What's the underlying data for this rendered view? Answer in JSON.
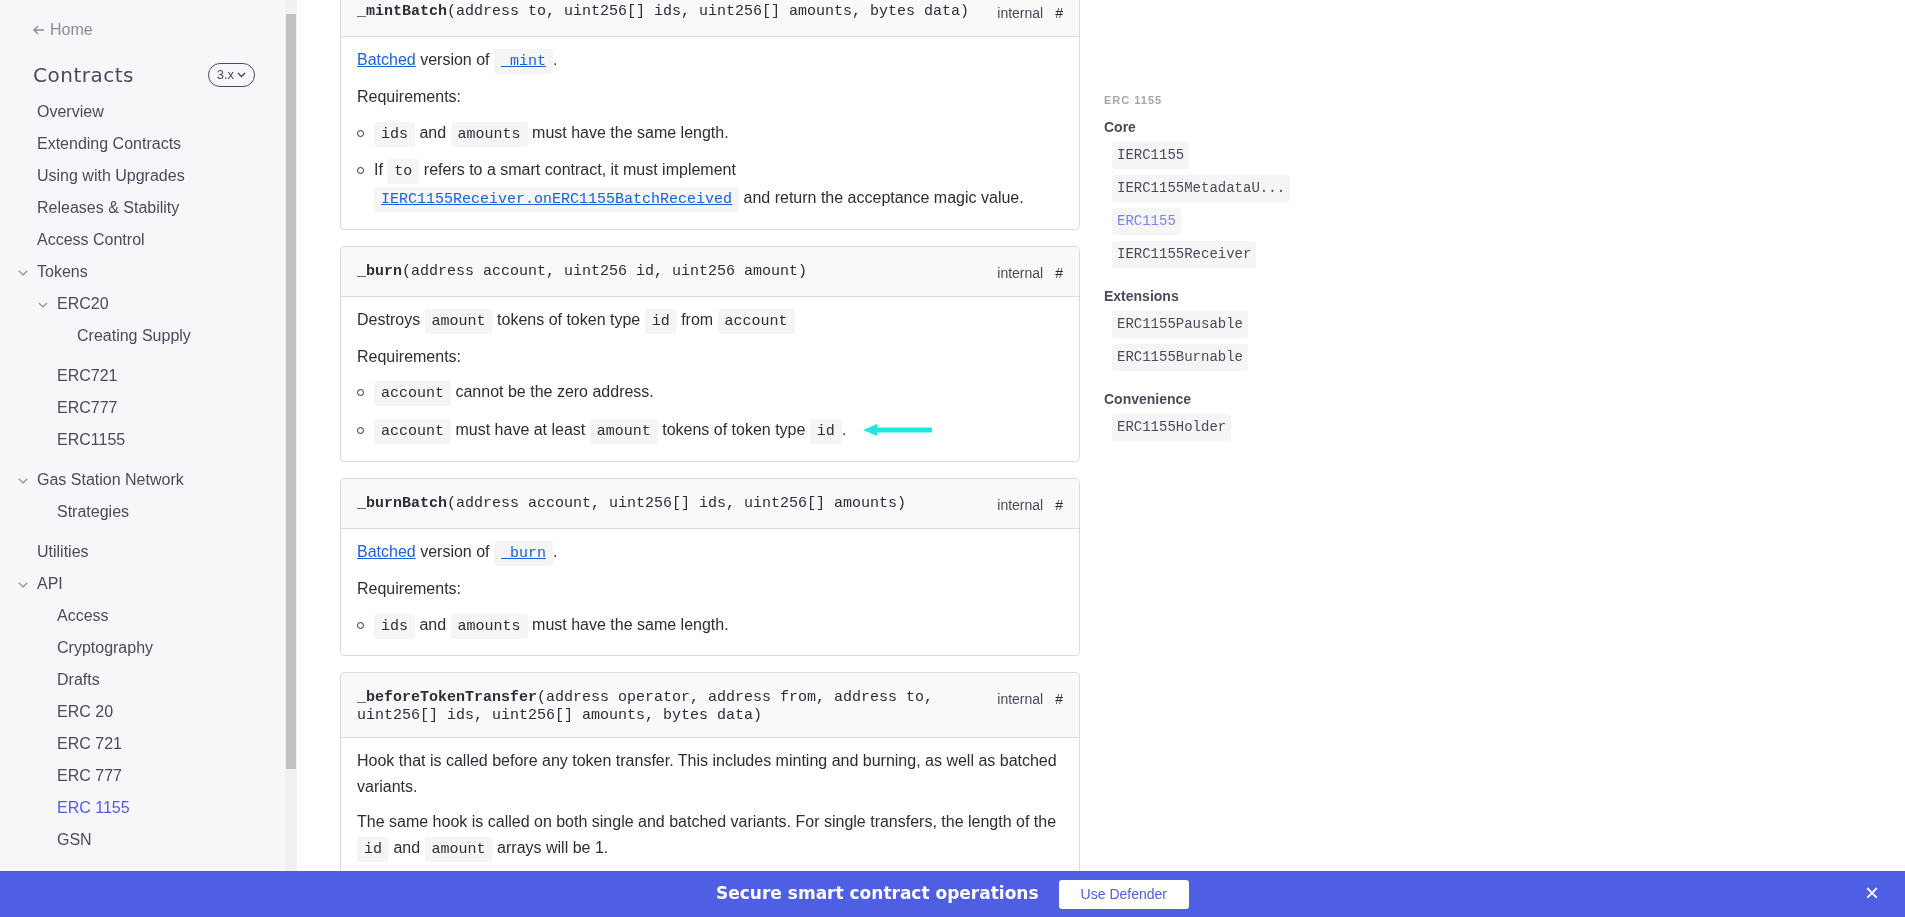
{
  "sidebar": {
    "home_link": "Home",
    "title": "Contracts",
    "version": "3.x",
    "items": [
      {
        "label": "Overview",
        "selected": false
      },
      {
        "label": "Extending Contracts",
        "selected": false
      },
      {
        "label": "Using with Upgrades",
        "selected": false
      },
      {
        "label": "Releases & Stability",
        "selected": false
      },
      {
        "label": "Access Control",
        "selected": false
      },
      {
        "label": "Tokens",
        "selected": false,
        "expanded": true,
        "children": [
          {
            "label": "ERC20",
            "selected": false,
            "expanded": true,
            "children": [
              {
                "label": "Creating Supply",
                "selected": false
              }
            ]
          },
          {
            "label": "ERC721",
            "selected": false
          },
          {
            "label": "ERC777",
            "selected": false
          },
          {
            "label": "ERC1155",
            "selected": false
          }
        ]
      },
      {
        "label": "Gas Station Network",
        "selected": false,
        "expanded": true,
        "children": [
          {
            "label": "Strategies",
            "selected": false
          }
        ]
      },
      {
        "label": "Utilities",
        "selected": false
      },
      {
        "label": "API",
        "selected": false,
        "expanded": true,
        "children": [
          {
            "label": "Access",
            "selected": false
          },
          {
            "label": "Cryptography",
            "selected": false
          },
          {
            "label": "Drafts",
            "selected": false
          },
          {
            "label": "ERC 20",
            "selected": false
          },
          {
            "label": "ERC 721",
            "selected": false
          },
          {
            "label": "ERC 777",
            "selected": false
          },
          {
            "label": "ERC 1155",
            "selected": true
          },
          {
            "label": "GSN",
            "selected": false
          }
        ]
      }
    ]
  },
  "functions": [
    {
      "name": "_mintBatch",
      "params": "(address to, uint256[] ids, uint256[] amounts, bytes data)",
      "visibility": "internal",
      "anchor": "#",
      "body": [
        {
          "kind": "paragraph",
          "segments": [
            {
              "kind": "link",
              "text": "Batched"
            },
            {
              "kind": "text",
              "text": " version of "
            },
            {
              "kind": "code-link",
              "text": "_mint"
            },
            {
              "kind": "text",
              "text": "."
            }
          ]
        },
        {
          "kind": "paragraph",
          "segments": [
            {
              "kind": "text",
              "text": "Requirements:"
            }
          ]
        },
        {
          "kind": "list",
          "items": [
            {
              "highlighted": false,
              "segments": [
                {
                  "kind": "code",
                  "text": "ids"
                },
                {
                  "kind": "text",
                  "text": " and "
                },
                {
                  "kind": "code",
                  "text": "amounts"
                },
                {
                  "kind": "text",
                  "text": " must have the same length."
                }
              ]
            },
            {
              "highlighted": false,
              "segments": [
                {
                  "kind": "text",
                  "text": "If "
                },
                {
                  "kind": "code",
                  "text": "to"
                },
                {
                  "kind": "text",
                  "text": " refers to a smart contract, it must implement "
                },
                {
                  "kind": "code-link",
                  "text": "IERC1155Receiver.onERC1155BatchReceived"
                },
                {
                  "kind": "text",
                  "text": " and return the acceptance magic value."
                }
              ]
            }
          ]
        }
      ]
    },
    {
      "name": "_burn",
      "params": "(address account, uint256 id, uint256 amount)",
      "visibility": "internal",
      "anchor": "#",
      "body": [
        {
          "kind": "paragraph",
          "segments": [
            {
              "kind": "text",
              "text": "Destroys "
            },
            {
              "kind": "code",
              "text": "amount"
            },
            {
              "kind": "text",
              "text": " tokens of token type "
            },
            {
              "kind": "code",
              "text": "id"
            },
            {
              "kind": "text",
              "text": " from "
            },
            {
              "kind": "code",
              "text": "account"
            }
          ]
        },
        {
          "kind": "paragraph",
          "segments": [
            {
              "kind": "text",
              "text": "Requirements:"
            }
          ]
        },
        {
          "kind": "list",
          "items": [
            {
              "highlighted": false,
              "segments": [
                {
                  "kind": "code",
                  "text": "account"
                },
                {
                  "kind": "text",
                  "text": " cannot be the zero address."
                }
              ]
            },
            {
              "highlighted": true,
              "segments": [
                {
                  "kind": "code",
                  "text": "account"
                },
                {
                  "kind": "text",
                  "text": " must have at least "
                },
                {
                  "kind": "code",
                  "text": "amount"
                },
                {
                  "kind": "text",
                  "text": " tokens of token type "
                },
                {
                  "kind": "code",
                  "text": "id"
                },
                {
                  "kind": "text",
                  "text": "."
                }
              ]
            }
          ]
        }
      ]
    },
    {
      "name": "_burnBatch",
      "params": "(address account, uint256[] ids, uint256[] amounts)",
      "visibility": "internal",
      "anchor": "#",
      "body": [
        {
          "kind": "paragraph",
          "segments": [
            {
              "kind": "link",
              "text": "Batched"
            },
            {
              "kind": "text",
              "text": " version of "
            },
            {
              "kind": "code-link",
              "text": "_burn"
            },
            {
              "kind": "text",
              "text": "."
            }
          ]
        },
        {
          "kind": "paragraph",
          "segments": [
            {
              "kind": "text",
              "text": "Requirements:"
            }
          ]
        },
        {
          "kind": "list",
          "items": [
            {
              "highlighted": false,
              "segments": [
                {
                  "kind": "code",
                  "text": "ids"
                },
                {
                  "kind": "text",
                  "text": " and "
                },
                {
                  "kind": "code",
                  "text": "amounts"
                },
                {
                  "kind": "text",
                  "text": " must have the same length."
                }
              ]
            }
          ]
        }
      ]
    },
    {
      "name": "_beforeTokenTransfer",
      "params": "(address operator, address from, address to, uint256[] ids, uint256[] amounts, bytes data)",
      "visibility": "internal",
      "anchor": "#",
      "body": [
        {
          "kind": "paragraph",
          "segments": [
            {
              "kind": "text",
              "text": "Hook that is called before any token transfer. This includes minting and burning, as well as batched variants."
            }
          ]
        },
        {
          "kind": "paragraph",
          "segments": [
            {
              "kind": "text",
              "text": "The same hook is called on both single and batched variants. For single transfers, the length of the "
            },
            {
              "kind": "code",
              "text": "id"
            },
            {
              "kind": "text",
              "text": " and "
            },
            {
              "kind": "code",
              "text": "amount"
            },
            {
              "kind": "text",
              "text": " arrays will be 1."
            }
          ]
        }
      ]
    }
  ],
  "toc": {
    "heading": "ERC 1155",
    "groups": [
      {
        "title": "Core",
        "items": [
          {
            "label": "IERC1155",
            "selected": false
          },
          {
            "label": "IERC1155MetadataU...",
            "selected": false
          },
          {
            "label": "ERC1155",
            "selected": true
          },
          {
            "label": "IERC1155Receiver",
            "selected": false
          }
        ]
      },
      {
        "title": "Extensions",
        "items": [
          {
            "label": "ERC1155Pausable",
            "selected": false
          },
          {
            "label": "ERC1155Burnable",
            "selected": false
          }
        ]
      },
      {
        "title": "Convenience",
        "items": [
          {
            "label": "ERC1155Holder",
            "selected": false
          }
        ]
      }
    ]
  },
  "banner": {
    "text": "Secure smart contract operations",
    "button": "Use Defender",
    "close": "×"
  }
}
